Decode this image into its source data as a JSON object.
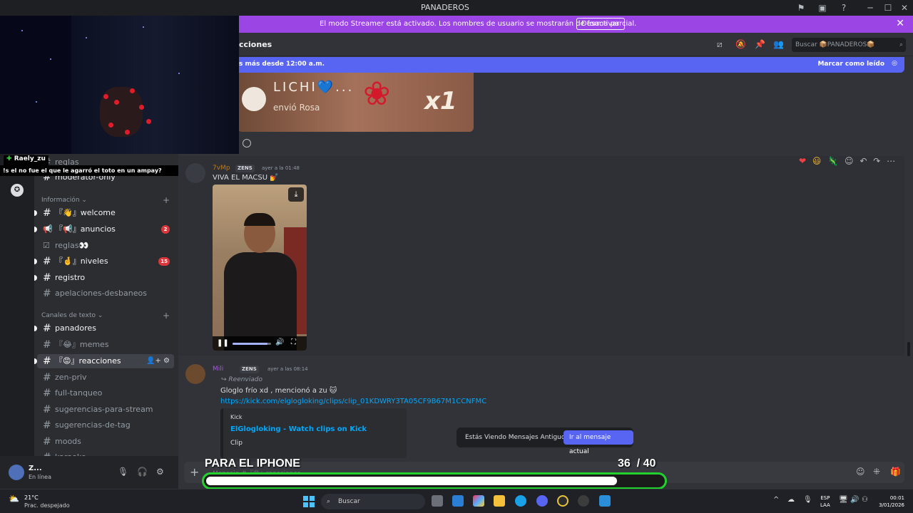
{
  "window": {
    "title": "PANADEROS",
    "min": "─",
    "max": "☐",
    "close": "✕",
    "inbox_icon": "▣",
    "help_icon": "?"
  },
  "streamer_banner": {
    "message": "El modo Streamer está activado. Los nombres de usuario se mostrarán de forma parcial.",
    "button": "Desactivar",
    "close": "✕"
  },
  "stream_overlay": {
    "chat_user": "Raely_zu",
    "chat_message": "!s el no fue el que le agarró el toto en un ampay?",
    "goal_title": "PARA EL IPHONE",
    "goal_current": "36",
    "goal_total": "/ 40",
    "goal_progress": 0.9
  },
  "sidebar": {
    "partial_items": [
      {
        "label": "reglas"
      },
      {
        "label": "moderator-only"
      }
    ],
    "categories": [
      {
        "label": "Información ⌄",
        "plus": "+"
      },
      {
        "label": "Canales de texto ⌄",
        "plus": "+"
      }
    ],
    "info_channels": [
      {
        "icon": "#",
        "label": "『👋』welcome"
      },
      {
        "icon": "📢",
        "label": "『📢』anuncios",
        "badge": "2"
      },
      {
        "icon": "☑",
        "label": "reglas👀"
      },
      {
        "icon": "#",
        "label": "『🤞』niveles",
        "badge": "15"
      },
      {
        "icon": "#",
        "label": "registro"
      },
      {
        "icon": "#",
        "label": "apelaciones-desbaneos"
      }
    ],
    "text_channels": [
      {
        "icon": "#",
        "label": "panadores"
      },
      {
        "icon": "#",
        "label": "『😂』memes"
      },
      {
        "icon": "#",
        "label": "『😡』reacciones",
        "icons": "👤+ ⚙"
      },
      {
        "icon": "#",
        "label": "zen-priv"
      },
      {
        "icon": "#",
        "label": "full-tanqueo"
      },
      {
        "icon": "#",
        "label": "sugerencias-para-stream"
      },
      {
        "icon": "#",
        "label": "sugerencias-de-tag"
      },
      {
        "icon": "#",
        "label": "moods"
      },
      {
        "icon": "#",
        "label": "karaoke"
      }
    ]
  },
  "user_panel": {
    "name": "Z...",
    "status": "En línea",
    "mic_icon": "🎙",
    "headset_icon": "🎧",
    "settings_icon": "⚙"
  },
  "header": {
    "channel": "cciones",
    "search_placeholder": "Buscar 📦PANADEROS📦",
    "search_icon": "⌕"
  },
  "new_messages_bar": {
    "left": "s más desde 12:00 a.m.",
    "right": "Marcar como leído"
  },
  "gift_card": {
    "name": "LICHI💙...",
    "sent": "envió Rosa",
    "count": "x1"
  },
  "messages": [
    {
      "author": "7vMp",
      "tag": "ZENS",
      "timestamp": "ayer a la 01:48",
      "text": "VIVA EL MACSU 💅"
    },
    {
      "author": "Mili",
      "tag": "ZENS",
      "timestamp": "ayer a las 08:14",
      "forwarded": "↪ Reenviado",
      "text": "Gloglo frío xd , mencionó a zu 🐱",
      "link": "https://kick.com/elglogloking/clips/clip_01KDWRY3TA05CF9B67M1CCNFMC",
      "embed": {
        "provider": "Kick",
        "title": "ElGlogloking - Watch clips on Kick",
        "description": "Clip"
      }
    }
  ],
  "reactions_bar": [
    "❤",
    "😃",
    "🦎",
    "☺",
    "↶",
    "↷",
    "⋯"
  ],
  "jump_banner": {
    "text": "Estás Viendo Mensajes Antiguos",
    "button": "Ir al mensaje actual"
  },
  "composer": {
    "plus": "+",
    "placeholder": "Mensaje #『😡』reacciones"
  },
  "taskbar": {
    "weather_temp": "21°C",
    "weather_desc": "Prac. despejado",
    "search_label": "Buscar",
    "lang_top": "ESP",
    "lang_bottom": "LAA",
    "time": "00:01",
    "date": "3/01/2026"
  },
  "colors": {
    "streamer": "#9b45e4",
    "blurple": "#5865f2",
    "goal_border": "#21d12c",
    "badge_red": "#da373c",
    "link": "#00a8fc"
  }
}
